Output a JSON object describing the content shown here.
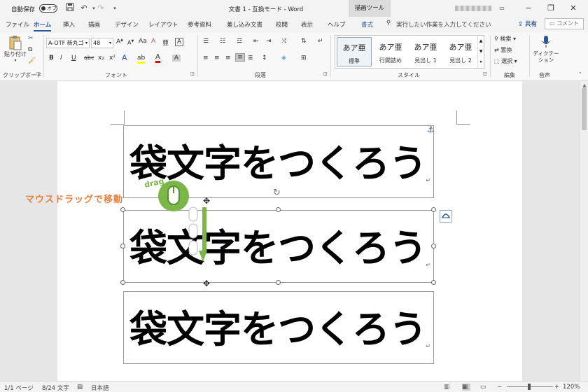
{
  "titlebar": {
    "autosave_label": "自動保存",
    "autosave_state": "オフ",
    "doc_title": "文書 1 - 互換モード - Word",
    "context_tab": "描画ツール",
    "minimize": "−",
    "restore": "❐",
    "close": "✕",
    "save_icon": "save-icon",
    "undo_icon": "undo-icon",
    "redo_icon": "redo-icon"
  },
  "tabs": {
    "items": [
      "ファイル",
      "ホーム",
      "挿入",
      "描画",
      "デザイン",
      "レイアウト",
      "参考資料",
      "差し込み文書",
      "校閲",
      "表示",
      "ヘルプ",
      "書式"
    ],
    "active": "ホーム",
    "tellme": "実行したい作業を入力してください",
    "share": "共有",
    "comment": "コメント"
  },
  "ribbon": {
    "clipboard": {
      "paste_label": "貼り付け",
      "group": "クリップボード"
    },
    "font": {
      "name": "A-OTF 新丸ゴ",
      "size": "48",
      "group": "フォント",
      "bold": "B",
      "italic": "I",
      "underline": "U",
      "strike": "abc",
      "sub": "x₂",
      "sup": "x²",
      "effects": "A",
      "highlight": "ab",
      "color": "A",
      "grow": "A",
      "shrink": "A",
      "case": "Aa",
      "clear": "A",
      "phonetic": "亜",
      "border": "A"
    },
    "paragraph": {
      "group": "段落"
    },
    "styles": {
      "group": "スタイル",
      "items": [
        {
          "preview": "あア亜",
          "name": "標準"
        },
        {
          "preview": "あア亜",
          "name": "行間詰め"
        },
        {
          "preview": "あア亜",
          "name": "見出し 1"
        },
        {
          "preview": "あア亜",
          "name": "見出し 2"
        }
      ]
    },
    "editing": {
      "group": "編集",
      "find": "検索",
      "replace": "置換",
      "select": "選択"
    },
    "voice": {
      "group": "音声",
      "dictate": "ディクテーション"
    }
  },
  "document": {
    "text": "袋文字をつくろう",
    "annotation": "マウスドラッグで移動",
    "drag_label": "drag",
    "para_mark": "↵"
  },
  "status": {
    "page": "1/1 ページ",
    "words": "8/24 文字",
    "language": "日本語",
    "zoom": "120%",
    "zoom_minus": "−",
    "zoom_plus": "+"
  },
  "colors": {
    "accent": "#2b579a",
    "annotation": "#e87f3e",
    "drag_green": "#7ab648"
  }
}
